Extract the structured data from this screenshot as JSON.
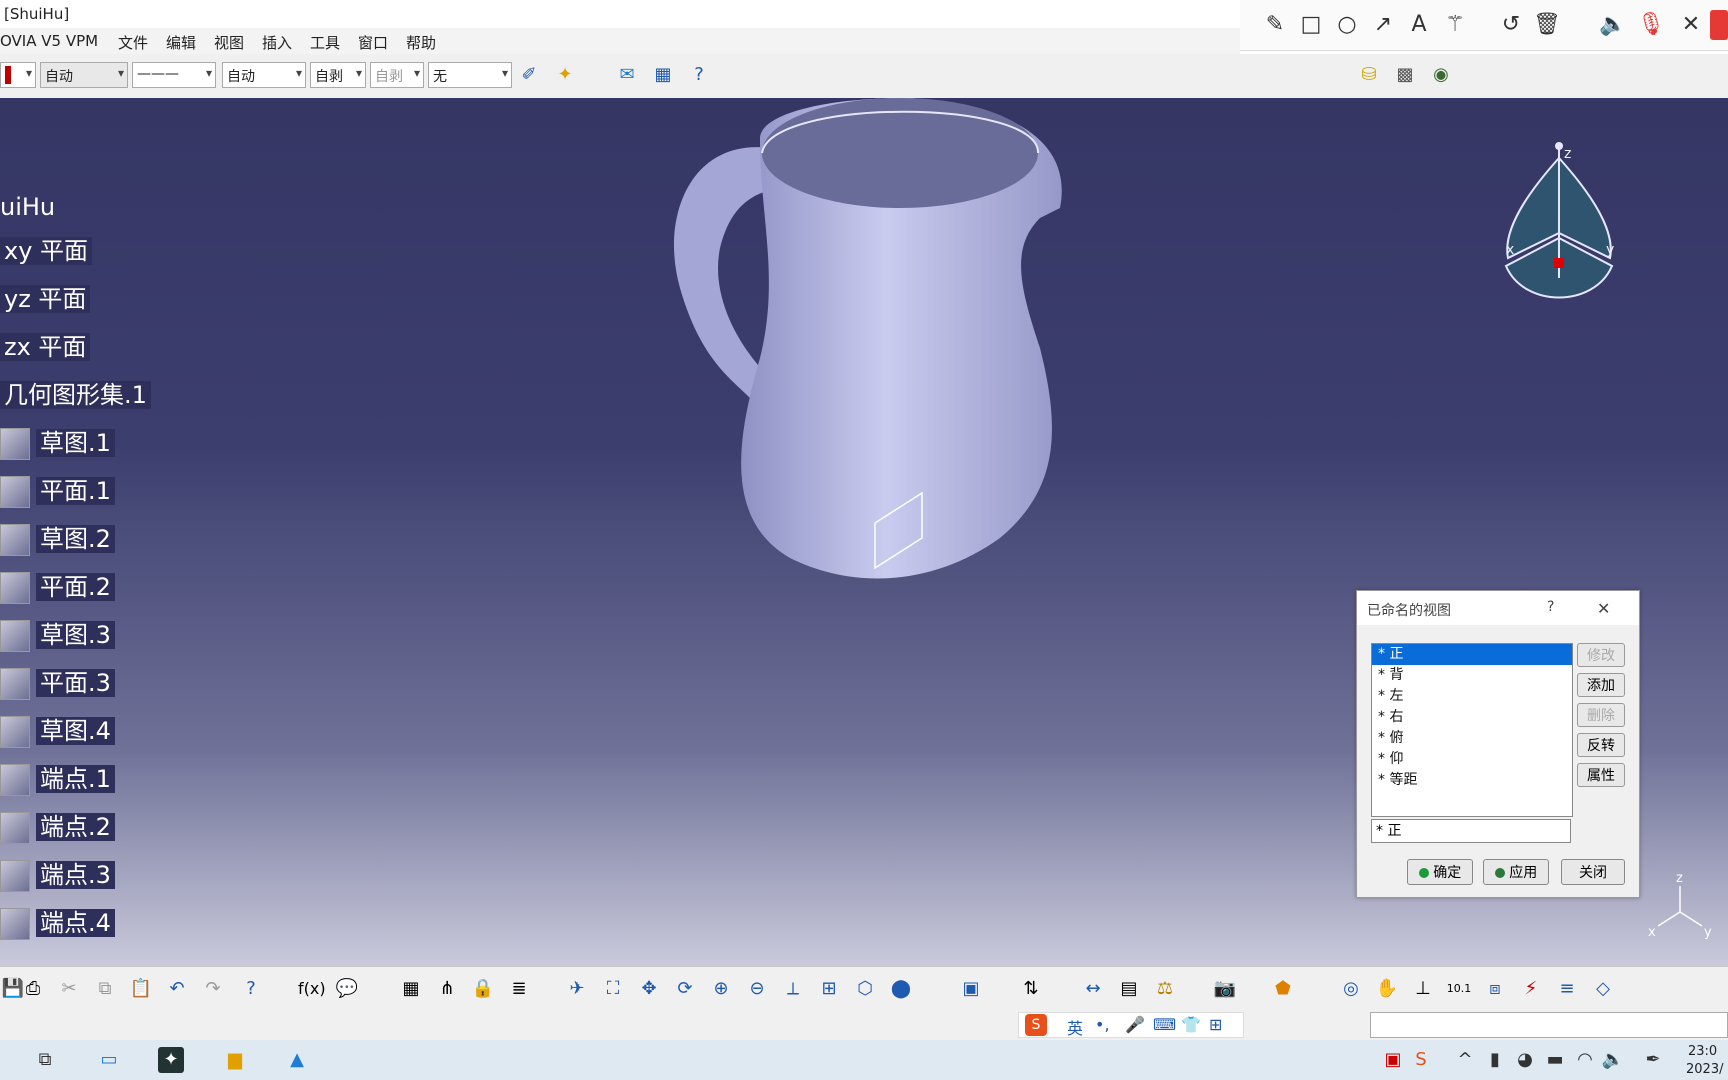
{
  "window": {
    "title": "[ShuiHu]"
  },
  "menu": {
    "items": [
      "OVIA V5 VPM",
      "文件",
      "编辑",
      "视图",
      "插入",
      "工具",
      "窗口",
      "帮助"
    ]
  },
  "toolbar": {
    "color_value": "",
    "combo1": "自动",
    "combo2": "———",
    "combo3": "自动",
    "combo4": "自剥",
    "combo5": "自剥",
    "combo6": "无"
  },
  "tree": {
    "root": "uiHu",
    "items": [
      {
        "label": "xy 平面",
        "icon": "none"
      },
      {
        "label": "yz 平面",
        "icon": "none"
      },
      {
        "label": "zx 平面",
        "icon": "none"
      },
      {
        "label": "几何图形集.1",
        "icon": "none"
      },
      {
        "label": "草图.1",
        "icon": "sketch-icon"
      },
      {
        "label": "平面.1",
        "icon": "plane-icon"
      },
      {
        "label": "草图.2",
        "icon": "sketch-icon"
      },
      {
        "label": "平面.2",
        "icon": "plane-icon"
      },
      {
        "label": "草图.3",
        "icon": "sketch-icon"
      },
      {
        "label": "平面.3",
        "icon": "plane-icon"
      },
      {
        "label": "草图.4",
        "icon": "sketch-icon"
      },
      {
        "label": "端点.1",
        "icon": "point-icon"
      },
      {
        "label": "端点.2",
        "icon": "point-icon"
      },
      {
        "label": "端点.3",
        "icon": "point-icon"
      },
      {
        "label": "端点.4",
        "icon": "point-icon"
      }
    ]
  },
  "compass": {
    "z": "z",
    "x": "x",
    "y": "y"
  },
  "axis_triad": {
    "z": "z",
    "x": "x",
    "y": "y"
  },
  "dialog": {
    "title": "已命名的视图",
    "help": "?",
    "close": "✕",
    "views": [
      "* 正",
      "* 背",
      "* 左",
      "* 右",
      "* 俯",
      "* 仰",
      "* 等距"
    ],
    "selected_index": 0,
    "current_value": "* 正",
    "side_buttons": [
      {
        "label": "修改",
        "enabled": false
      },
      {
        "label": "添加",
        "enabled": true
      },
      {
        "label": "删除",
        "enabled": false
      },
      {
        "label": "反转",
        "enabled": true
      },
      {
        "label": "属性",
        "enabled": true
      }
    ],
    "ok_label": "确定",
    "apply_label": "应用",
    "close_label": "关闭"
  },
  "ime": {
    "lang": "英"
  },
  "clock": {
    "time": "23:0",
    "date": "2023/"
  },
  "colors": {
    "viewport_top": "#353664",
    "viewport_bottom": "#c9cadb",
    "accent": "#0a6cd8",
    "part": "#b9bbe0"
  }
}
